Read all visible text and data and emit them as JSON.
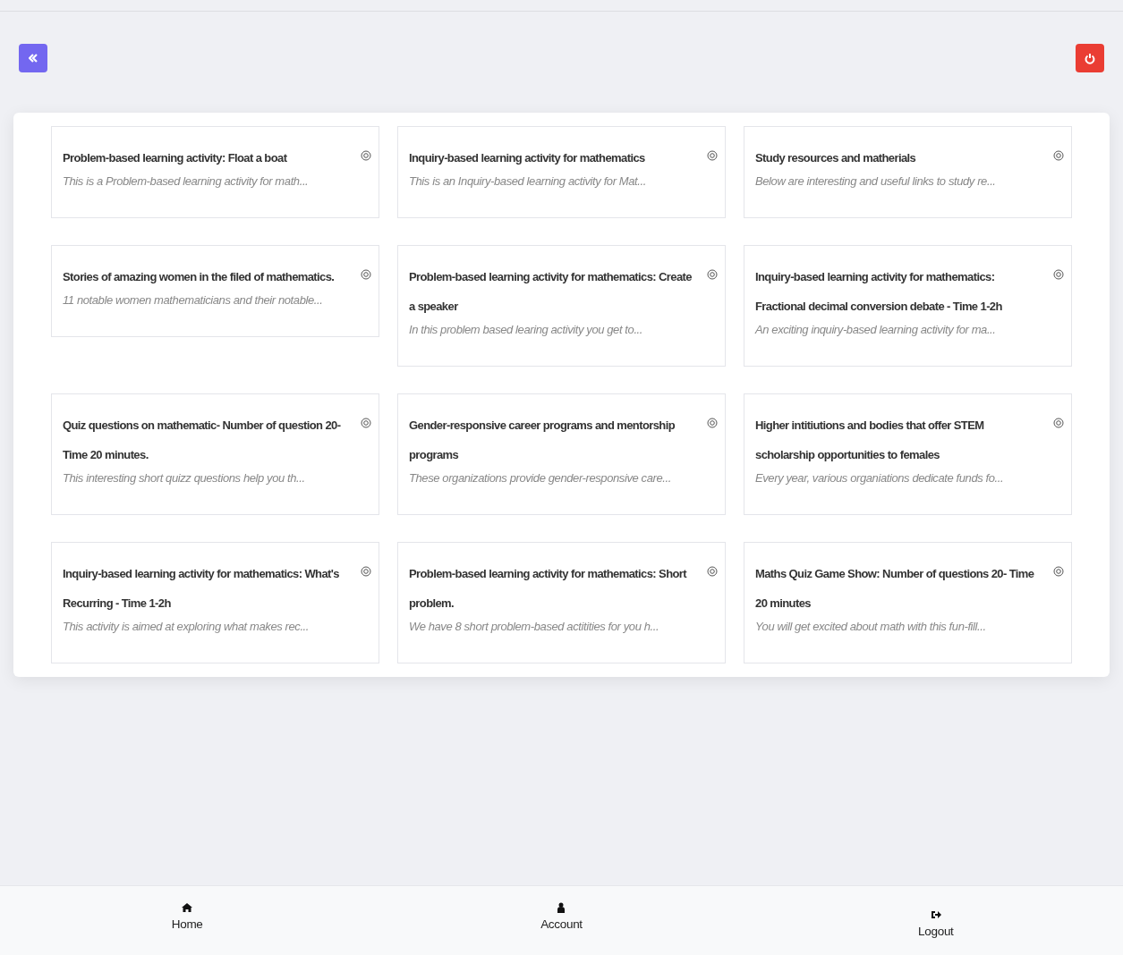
{
  "cards": [
    {
      "title": "Problem-based learning activity: Float a boat",
      "summary": "This is a Problem-based learning activity for math..."
    },
    {
      "title": "Inquiry-based learning activity for mathematics",
      "summary": "This is an Inquiry-based learning activity for Mat..."
    },
    {
      "title": "Study resources and matherials",
      "summary": "Below are interesting and useful links to study re..."
    },
    {
      "title": "Stories of amazing women in the filed of mathematics.",
      "summary": "11 notable women mathematicians and their notable..."
    },
    {
      "title": "Problem-based learning activity for mathematics: Create a speaker",
      "summary": "In this problem based learing activity you get to..."
    },
    {
      "title": "Inquiry-based learning activity for mathematics: Fractional decimal conversion debate - Time 1-2h",
      "summary": "An exciting inquiry-based learning activity for ma..."
    },
    {
      "title": "Quiz questions on mathematic- Number of question 20- Time 20 minutes.",
      "summary": "This interesting short quizz questions help you th..."
    },
    {
      "title": "Gender-responsive career programs and mentorship programs",
      "summary": "These organizations provide gender-responsive care..."
    },
    {
      "title": "Higher intitiutions and bodies that offer STEM scholarship opportunities to females",
      "summary": "Every year, various organiations dedicate funds fo..."
    },
    {
      "title": "Inquiry-based learning activity for mathematics: What's Recurring - Time 1-2h",
      "summary": "This activity is aimed at exploring what makes rec..."
    },
    {
      "title": "Problem-based learning activity for mathematics: Short problem.",
      "summary": "We have 8 short problem-based actitities for you h..."
    },
    {
      "title": "Maths Quiz Game Show: Number of questions 20- Time 20 minutes",
      "summary": "You will get excited about math with this fun-fill..."
    }
  ],
  "nav": [
    {
      "kind": "home",
      "label": "Home"
    },
    {
      "kind": "account",
      "label": "Account"
    },
    {
      "kind": "logout",
      "label": "Logout"
    }
  ]
}
